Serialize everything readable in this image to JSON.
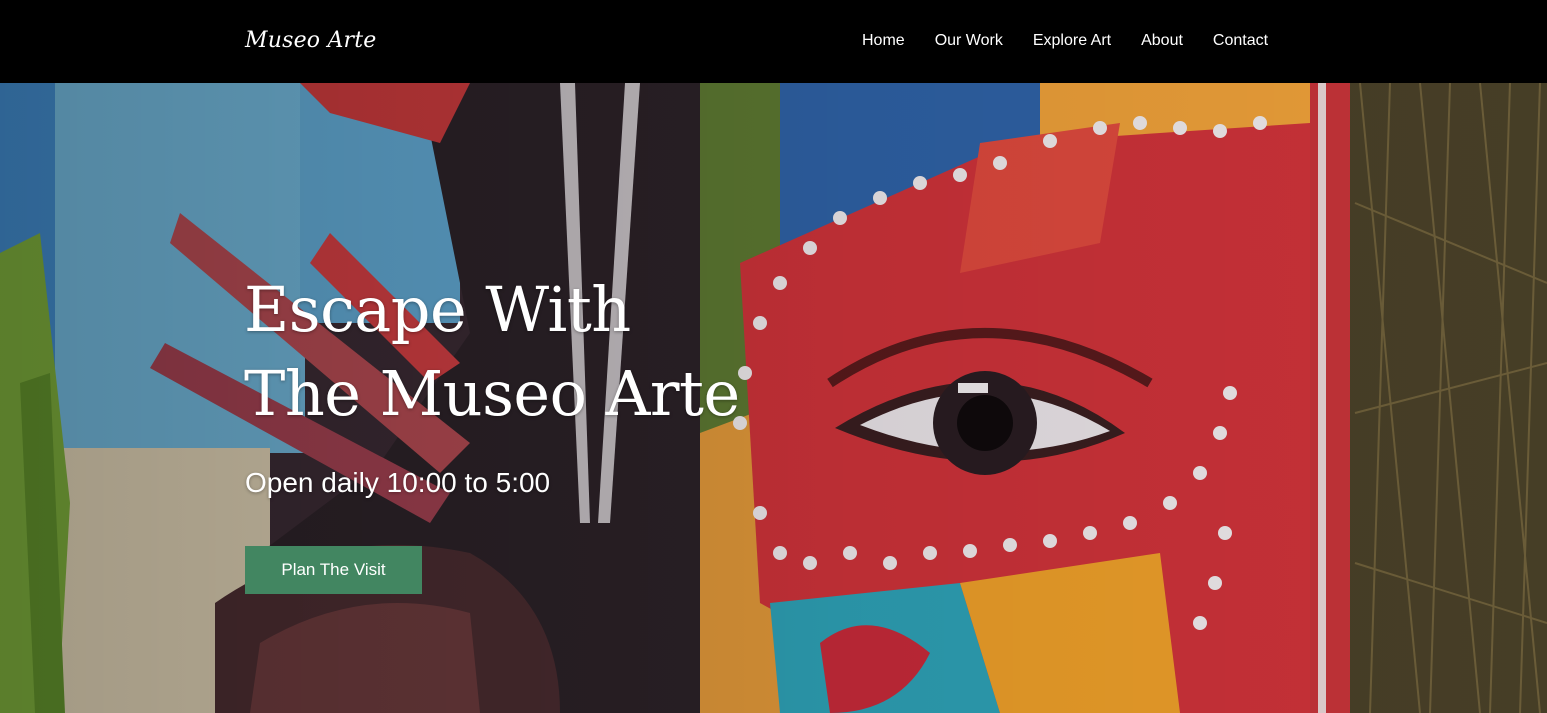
{
  "brand": {
    "logo_text": "Museo Arte"
  },
  "nav": {
    "items": [
      {
        "label": "Home"
      },
      {
        "label": "Our Work"
      },
      {
        "label": "Explore Art"
      },
      {
        "label": "About"
      },
      {
        "label": "Contact"
      }
    ]
  },
  "hero": {
    "title_line1": "Escape With",
    "title_line2": "The Museo Arte",
    "hours": "Open daily 10:00 to 5:00",
    "cta_label": "Plan The Visit",
    "background": "colorful-mural-face-eye"
  },
  "colors": {
    "nav_background": "#000000",
    "text": "#ffffff",
    "cta_background": "#428661"
  }
}
